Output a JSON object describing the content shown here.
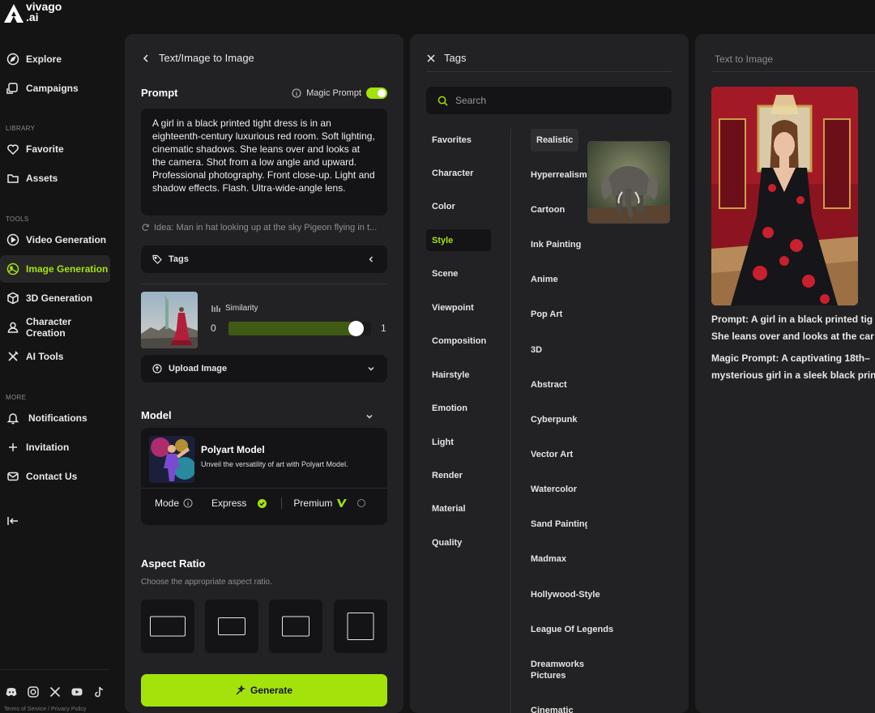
{
  "brand": {
    "logo_top": "vivago",
    "logo_bottom": ".ai"
  },
  "sidebar": {
    "items_top": [
      {
        "label": "Explore",
        "icon": "compass-icon"
      },
      {
        "label": "Campaigns",
        "icon": "campaign-icon"
      }
    ],
    "section_library": "LIBRARY",
    "items_library": [
      {
        "label": "Favorite",
        "icon": "heart-icon"
      },
      {
        "label": "Assets",
        "icon": "folder-icon"
      }
    ],
    "section_tools": "TOOLS",
    "items_tools": [
      {
        "label": "Video Generation",
        "icon": "video-icon"
      },
      {
        "label": "Image Generation",
        "icon": "image-icon",
        "active": true
      },
      {
        "label": "3D Generation",
        "icon": "cube-icon"
      },
      {
        "label": "Character Creation",
        "icon": "user-icon"
      },
      {
        "label": "AI Tools",
        "icon": "tools-icon"
      }
    ],
    "section_more": "MORE",
    "items_more": [
      {
        "label": "Notifications",
        "icon": "bell-icon"
      },
      {
        "label": "Invitation",
        "icon": "plus-icon"
      },
      {
        "label": "Contact Us",
        "icon": "mail-icon"
      }
    ],
    "footer": {
      "terms": "Terms of Service",
      "privacy": "Privacy Policy",
      "separator": "/"
    }
  },
  "left_panel": {
    "header": "Text/Image to Image",
    "prompt_label": "Prompt",
    "magic_prompt_label": "Magic Prompt",
    "magic_prompt_on": true,
    "prompt_text": "A girl in a black printed tight dress is in an eighteenth-century luxurious red room. Soft lighting, cinematic shadows. She leans over and looks at the camera. Shot from a low angle and upward. Professional photography. Front close-up. Light and shadow effects. Flash. Ultra-wide-angle lens.",
    "idea_text": "Idea: Man in hat looking up at the sky Pigeon flying in t...",
    "tags_button": "Tags",
    "similarity_label": "Similarity",
    "similarity_min": "0",
    "similarity_max": "1",
    "similarity_value": 0.89,
    "upload_button": "Upload Image",
    "model_label": "Model",
    "model_name": "Polyart Model",
    "model_desc": "Unveil the versatility of art with Polyart Model.",
    "mode_label": "Mode",
    "mode_express": "Express",
    "mode_premium": "Premium",
    "aspect_label": "Aspect Ratio",
    "aspect_sub": "Choose the appropriate aspect ratio.",
    "generate_button": "Generate"
  },
  "tags_panel": {
    "header": "Tags",
    "search_placeholder": "Search",
    "categories": [
      "Favorites",
      "Character",
      "Color",
      "Style",
      "Scene",
      "Viewpoint",
      "Composition",
      "Hairstyle",
      "Emotion",
      "Light",
      "Render",
      "Material",
      "Quality"
    ],
    "active_category": "Style",
    "options": [
      "Realistic",
      "Hyperrealism",
      "Cartoon",
      "Ink Painting",
      "Anime",
      "Pop Art",
      "3D",
      "Abstract",
      "Cyberpunk",
      "Vector Art",
      "Watercolor",
      "Sand Painting",
      "Madmax",
      "Hollywood-Style",
      "League Of Legends",
      "Dreamworks Pictures",
      "Cinematic"
    ],
    "selected_option": "Realistic"
  },
  "right_panel": {
    "title": "Text to Image",
    "prompt_line1": "Prompt: A girl in a black printed tig",
    "prompt_line2": "She leans over and looks at the car",
    "magic_line1": "Magic Prompt: A captivating 18th–",
    "magic_line2": "mysterious girl in a sleek black prin"
  },
  "colors": {
    "accent": "#a4e20c",
    "panel": "#222224",
    "field": "#141416",
    "background": "#141414"
  }
}
